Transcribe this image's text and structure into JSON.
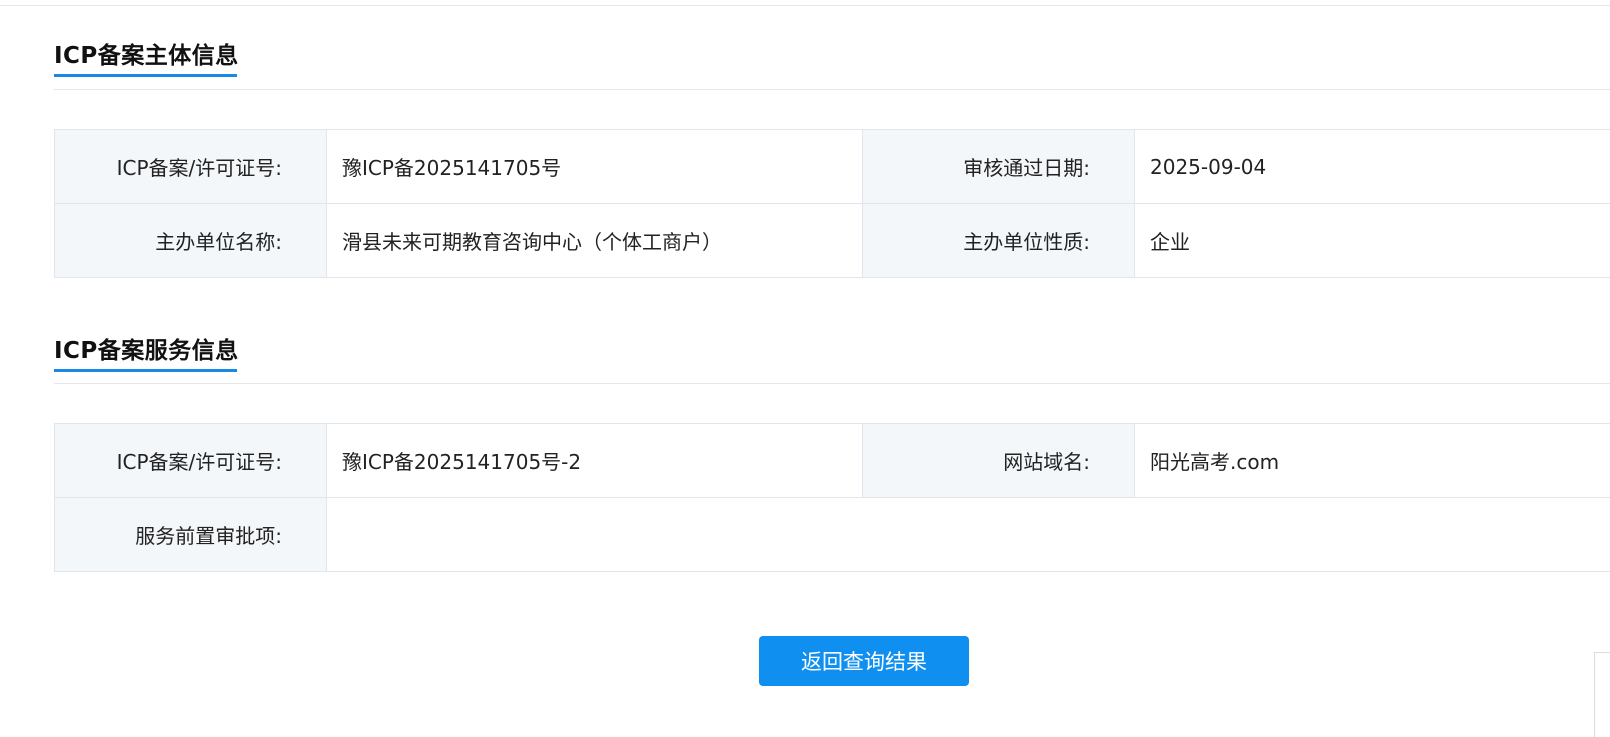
{
  "subject_section": {
    "title": "ICP备案主体信息",
    "rows": [
      {
        "label1": "ICP备案/许可证号:",
        "value1": "豫ICP备2025141705号",
        "label2": "审核通过日期:",
        "value2": "2025-09-04"
      },
      {
        "label1": "主办单位名称:",
        "value1": "滑县未来可期教育咨询中心（个体工商户）",
        "label2": "主办单位性质:",
        "value2": "企业"
      }
    ]
  },
  "service_section": {
    "title": "ICP备案服务信息",
    "rows": [
      {
        "label1": "ICP备案/许可证号:",
        "value1": "豫ICP备2025141705号-2",
        "label2": "网站域名:",
        "value2": "阳光高考.com"
      },
      {
        "label1": "服务前置审批项:",
        "value1": ""
      }
    ]
  },
  "actions": {
    "return_label": "返回查询结果"
  },
  "colors": {
    "accent": "#1a88e6",
    "button": "#0f8ff0",
    "label_bg": "#f3f7fa",
    "border": "#e2e6eb"
  }
}
